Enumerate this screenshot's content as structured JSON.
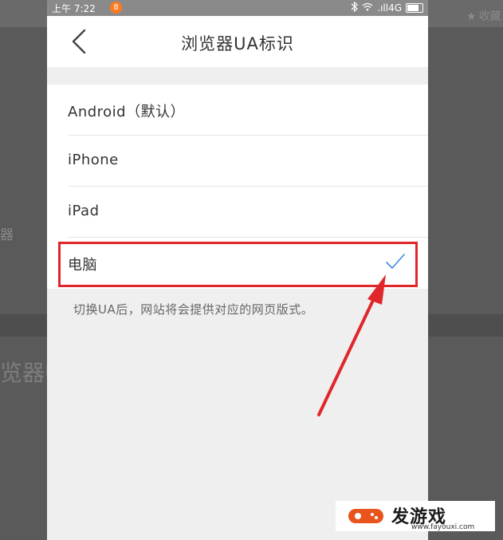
{
  "background": {
    "right_label": "收藏",
    "left_fragment": "器",
    "left_big_fragment": "览器U"
  },
  "status_bar": {
    "time": "上午 7:22",
    "notification_badge": "8",
    "network": ".ıll4G"
  },
  "nav": {
    "title": "浏览器UA标识",
    "back_icon": "chevron-left-icon"
  },
  "options": [
    {
      "label": "Android（默认）",
      "selected": false
    },
    {
      "label": "iPhone",
      "selected": false
    },
    {
      "label": "iPad",
      "selected": false
    },
    {
      "label": "电脑",
      "selected": true
    }
  ],
  "hint": "切换UA后，网站将会提供对应的网页版式。",
  "watermark": {
    "main": "发游戏",
    "sub": "www.fayouxi.com"
  },
  "colors": {
    "check": "#3d8ce6",
    "highlight": "#e0262a",
    "watermark_accent": "#e8541c"
  }
}
